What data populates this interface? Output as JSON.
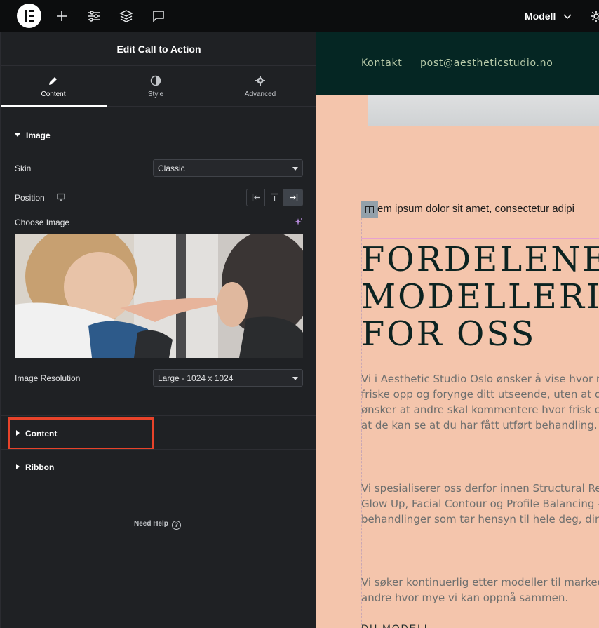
{
  "topbar": {
    "icons": [
      "elementor-logo-icon",
      "plus-icon",
      "sliders-icon",
      "layers-icon",
      "chat-icon"
    ],
    "document_name": "Modell"
  },
  "panel": {
    "title": "Edit Call to Action",
    "tabs": [
      {
        "label": "Content",
        "icon": "pencil-icon",
        "active": true
      },
      {
        "label": "Style",
        "icon": "half-circle-icon",
        "active": false
      },
      {
        "label": "Advanced",
        "icon": "gear-icon",
        "active": false
      }
    ],
    "image_section": {
      "heading": "Image",
      "skin_label": "Skin",
      "skin_value": "Classic",
      "position_label": "Position",
      "position_options": [
        "align-left-icon",
        "align-top-icon",
        "align-right-icon"
      ],
      "position_selected": "align-right-icon",
      "choose_image_label": "Choose Image",
      "resolution_label": "Image Resolution",
      "resolution_value": "Large - 1024 x 1024"
    },
    "sections": [
      {
        "label": "Content",
        "expanded": false,
        "highlighted": true
      },
      {
        "label": "Ribbon",
        "expanded": false,
        "highlighted": false
      }
    ],
    "need_help": "Need Help",
    "highlight_color": "#e8432a"
  },
  "preview": {
    "nav": [
      "Kontakt",
      "post@aestheticstudio.no"
    ],
    "lorem": "em ipsum dolor sit amet, consectetur adipi",
    "headline": [
      "FORDELENE",
      "MODELLERI",
      "FOR OSS"
    ],
    "paragraphs": [
      [
        "Vi i Aesthetic Studio Oslo ønsker å vise hvor m",
        "friske opp og forynge ditt utseende, uten at de",
        "ønsker at andre skal kommentere hvor frisk o",
        "at de kan se at du har fått utført behandling."
      ],
      [
        "Vi spesialiserer oss derfor innen Structural Rej",
        "Glow Up, Facial Contour og Profile Balancing –",
        "behandlinger som tar hensyn til hele deg, dine"
      ],
      [
        "Vi søker kontinuerlig etter modeller til marked",
        "andre hvor mye vi kan oppnå sammen."
      ]
    ],
    "bottom_partial": "DU MODELL",
    "colors": {
      "background": "#f4c5ac",
      "header": "#052623",
      "nav_text": "#b7c9a8",
      "headline": "#0c2321"
    }
  }
}
